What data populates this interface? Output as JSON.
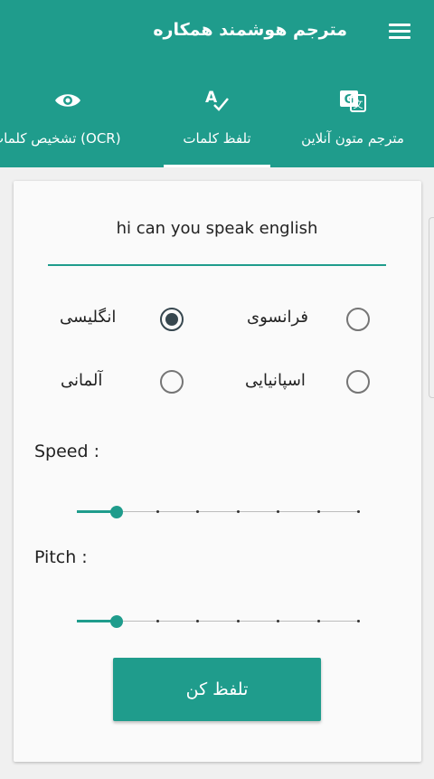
{
  "appbar": {
    "title": "مترجم هوشمند همکاره"
  },
  "tabs": [
    {
      "label": "مترجم متون آنلاین",
      "icon": "google-translate-icon"
    },
    {
      "label": "تلفظ کلمات",
      "icon": "spellcheck-icon",
      "selected": true
    },
    {
      "label": "تشخیص کلمات (OCR)",
      "icon": "eye-icon"
    }
  ],
  "input": {
    "value": "hi can you speak english"
  },
  "languages": [
    {
      "label": "انگلیسی",
      "checked": true
    },
    {
      "label": "فرانسوی",
      "checked": false
    },
    {
      "label": "آلمانی",
      "checked": false
    },
    {
      "label": "اسپانیایی",
      "checked": false
    }
  ],
  "speed": {
    "label": "Speed :",
    "value_fraction": 0.14
  },
  "pitch": {
    "label": "Pitch :",
    "value_fraction": 0.14
  },
  "button": {
    "label": "تلفظ کن"
  },
  "colors": {
    "accent": "#1f9c8c",
    "radio_checked": "#37474f"
  }
}
